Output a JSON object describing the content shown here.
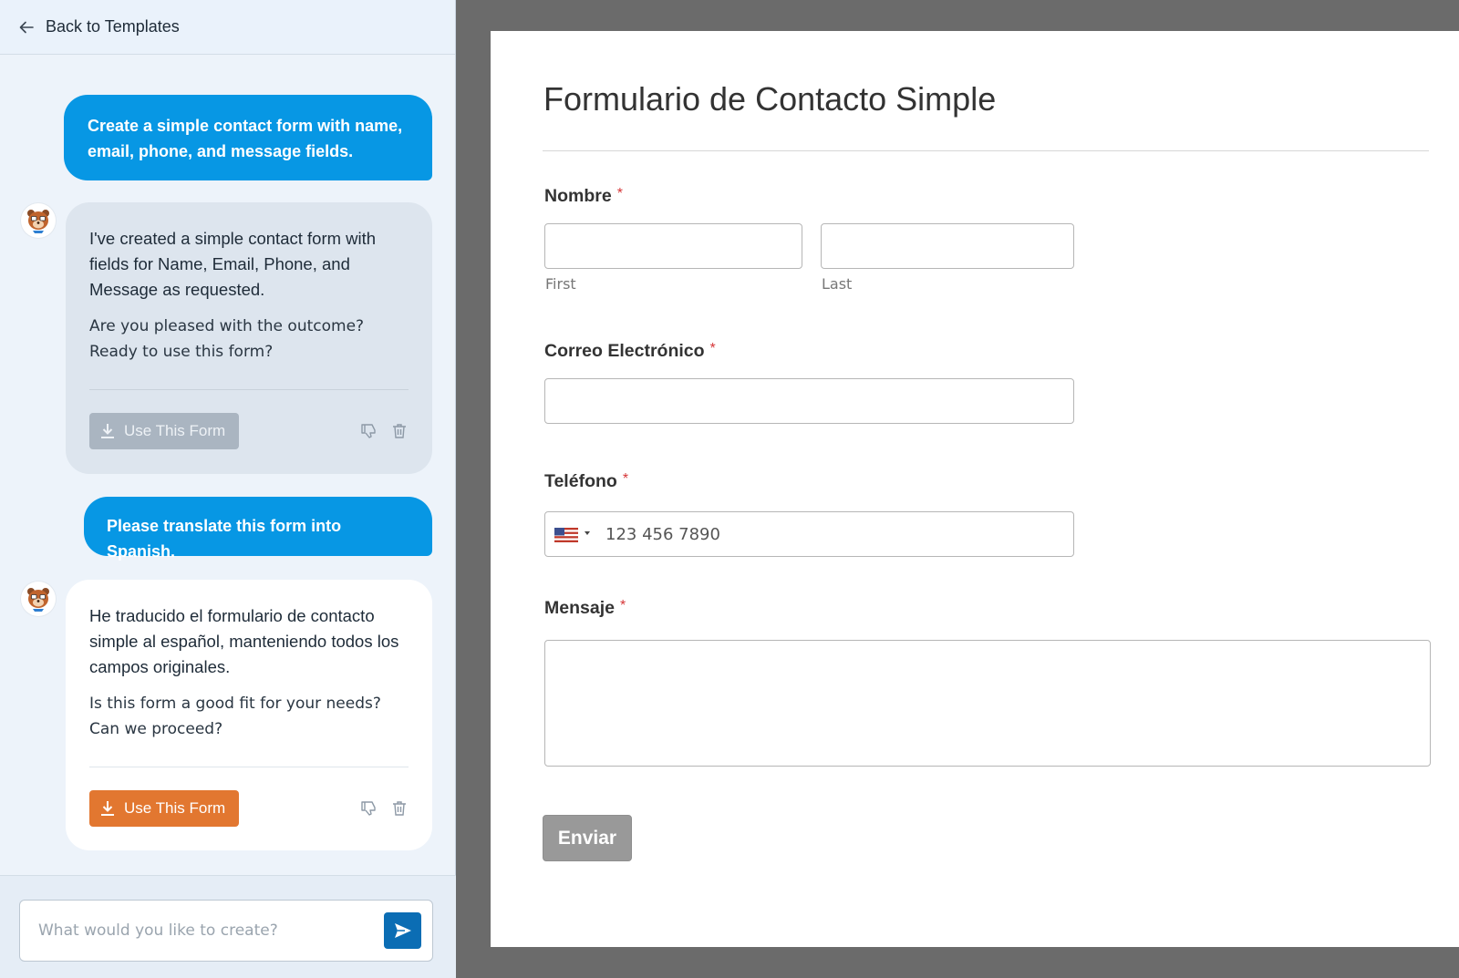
{
  "header": {
    "back_label": "Back to Templates"
  },
  "messages": {
    "user_1": "Create a simple contact form with name, email, phone, and message fields.",
    "ai_1": {
      "text": "I've created a simple contact form with fields for Name, Email, Phone, and Message as requested.",
      "question": "Are you pleased with the outcome? Ready to use this form?",
      "button_label": "Use This Form",
      "button_state": "disabled"
    },
    "user_2": "Please translate this form into Spanish.",
    "ai_2": {
      "text": "He traducido el formulario de contacto simple al español, manteniendo todos los campos originales.",
      "question": "Is this form a good fit for your needs? Can we proceed?",
      "button_label": "Use This Form",
      "button_state": "active"
    }
  },
  "composer": {
    "placeholder": "What would you like to create?"
  },
  "form": {
    "title": "Formulario de Contacto Simple",
    "required_marker": "*",
    "fields": {
      "name": {
        "label": "Nombre",
        "first_sublabel": "First",
        "last_sublabel": "Last"
      },
      "email": {
        "label": "Correo Electrónico"
      },
      "phone": {
        "label": "Teléfono",
        "placeholder": "123 456 7890",
        "country_flag": "us-flag-icon"
      },
      "message": {
        "label": "Mensaje"
      }
    },
    "submit_label": "Enviar"
  },
  "colors": {
    "user_bubble": "#0797e4",
    "use_button_active": "#e27730",
    "use_button_disabled": "#aab5c1",
    "send_button": "#0b6db4",
    "submit_button": "#999999",
    "required": "#d63638"
  }
}
